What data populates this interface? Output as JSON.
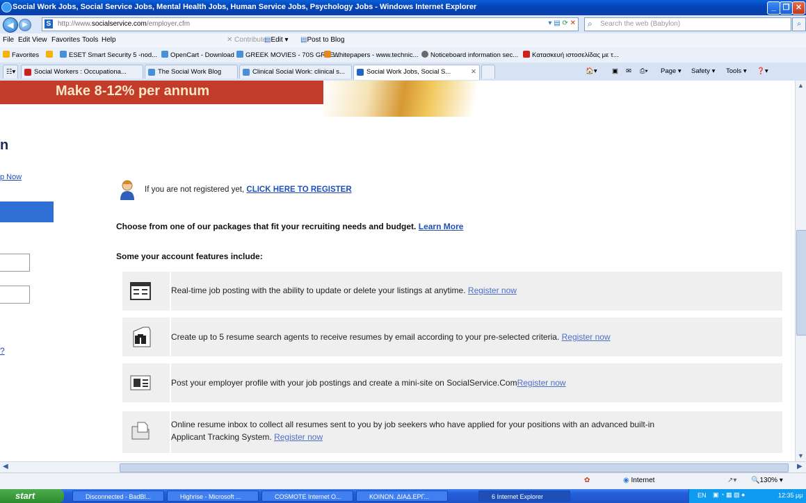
{
  "window": {
    "title": "Social Work Jobs, Social Service Jobs, Mental Health Jobs, Human Service Jobs, Psychology Jobs - Windows Internet Explorer"
  },
  "address": {
    "url_prefix": "http://www.",
    "url_domain": "socialservice.com",
    "url_path": "/employer.cfm",
    "search_placeholder": "Search the web (Babylon)"
  },
  "menu": {
    "items": [
      "File",
      "Edit",
      "View",
      "Favorites",
      "Tools",
      "Help"
    ],
    "contribute": "Contribute",
    "edit": "Edit",
    "post_to_blog": "Post to Blog"
  },
  "favorites": {
    "label": "Favorites",
    "items": [
      "ESET Smart Security 5 -nod...",
      "OpenCart - Download",
      "GREEK MOVIES - 70S GREE...",
      "Whitepapers - www.technic...",
      "Noticeboard information sec...",
      "Κατασκευή ιστοσελίδας με τ..."
    ]
  },
  "tabs": {
    "items": [
      "Social Workers : Occupationa...",
      "The Social Work Blog",
      "Clinical Social Work: clinical s...",
      "Social Work Jobs, Social S..."
    ],
    "tools": [
      "Page",
      "Safety",
      "Tools"
    ]
  },
  "page": {
    "banner": "Make 8-12% per annum",
    "left_heading": "n",
    "left_link": "p Now",
    "left_link2": "?",
    "register_text": "If you are not registered yet,",
    "register_link": "CLICK HERE TO REGISTER",
    "packages_text": "Choose from one of our packages that fit your recruiting needs and budget.",
    "learn_more": "Learn More",
    "features_heading": "Some your account features include:",
    "features": [
      {
        "icon": "list-icon",
        "text": "Real-time job posting with the ability to update or delete your listings at anytime.",
        "link": "Register now"
      },
      {
        "icon": "binoculars-icon",
        "text": "Create up to 5 resume search agents to receive resumes by email according to your pre-selected criteria.",
        "link": "Register now"
      },
      {
        "icon": "profile-card-icon",
        "text": "Post your employer profile with your job postings and create a mini-site on SocialService.Com",
        "link": "Register now"
      },
      {
        "icon": "folder-icon",
        "text": "Online resume inbox to collect all resumes sent to you by job seekers who have applied for your positions with an advanced built-in",
        "text2": "Applicant Tracking System.",
        "link": "Register now"
      }
    ]
  },
  "status": {
    "zone": "Internet",
    "zoom": "130%"
  },
  "taskbar": {
    "start": "start",
    "tasks": [
      "Disconnected - BadBl...",
      "Highrise - Microsoft ...",
      "COSMOTE Internet O...",
      "ΚΟΙΝΩΝ. ΔΙΑΔ.ΕΡΓ...",
      "6 Internet Explorer"
    ],
    "lang": "EN",
    "clock": "12:35 μμ"
  }
}
